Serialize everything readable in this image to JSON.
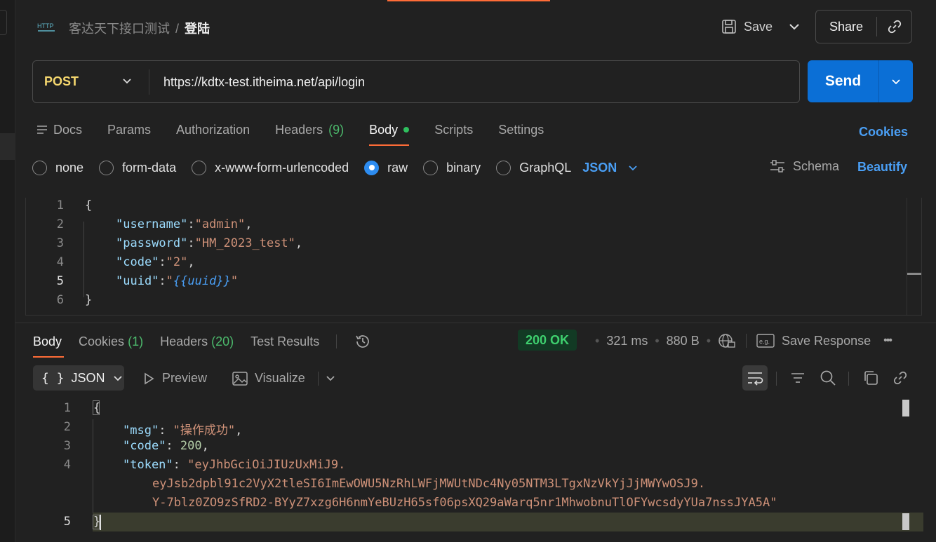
{
  "header": {
    "collection": "客达天下接口测试",
    "separator": "/",
    "request_name": "登陆",
    "save_label": "Save",
    "share_label": "Share"
  },
  "request": {
    "method": "POST",
    "url": "https://kdtx-test.itheima.net/api/login",
    "send_label": "Send"
  },
  "req_tabs": {
    "docs": "Docs",
    "params": "Params",
    "authorization": "Authorization",
    "headers": "Headers",
    "headers_count": "(9)",
    "body": "Body",
    "scripts": "Scripts",
    "settings": "Settings",
    "cookies": "Cookies"
  },
  "body_types": {
    "none": "none",
    "form_data": "form-data",
    "urlencoded": "x-www-form-urlencoded",
    "raw": "raw",
    "binary": "binary",
    "graphql": "GraphQL",
    "format": "JSON",
    "schema": "Schema",
    "beautify": "Beautify"
  },
  "request_body": {
    "line_numbers": [
      "1",
      "2",
      "3",
      "4",
      "5",
      "6"
    ],
    "open": "{",
    "close": "}",
    "fields": [
      {
        "key": "\"username\"",
        "value": "\"admin\"",
        "comma": ","
      },
      {
        "key": "\"password\"",
        "value": "\"HM_2023_test\"",
        "comma": ","
      },
      {
        "key": "\"code\"",
        "value": "\"2\"",
        "comma": ","
      }
    ],
    "uuid_key": "\"uuid\"",
    "uuid_var": "{{uuid}}"
  },
  "response_tabs": {
    "body": "Body",
    "cookies": "Cookies",
    "cookies_count": "(1)",
    "headers": "Headers",
    "headers_count": "(20)",
    "test_results": "Test Results"
  },
  "response_meta": {
    "status": "200 OK",
    "time": "321 ms",
    "size": "880 B",
    "bullet": "•",
    "save_response": "Save Response",
    "more": "•••"
  },
  "response_toolbar": {
    "format": "JSON",
    "format_icon": "{ }",
    "preview": "Preview",
    "visualize": "Visualize"
  },
  "response_body": {
    "line_numbers": [
      "1",
      "2",
      "3",
      "4",
      "",
      "",
      "5"
    ],
    "open": "{",
    "close": "}",
    "msg_key": "\"msg\"",
    "msg_value": "\"操作成功\"",
    "code_key": "\"code\"",
    "code_value": "200",
    "token_key": "\"token\"",
    "token_line1": "\"eyJhbGciOiJIUzUxMiJ9.",
    "token_line2": "eyJsb2dpbl91c2VyX2tleSI6ImEwOWU5NzRhLWFjMWUtNDc4Ny05NTM3LTgxNzVkYjJjMWYwOSJ9.",
    "token_line3": "Y-7blz0ZO9zSfRD2-BYyZ7xzg6H6nmYeBUzH65sf06psXQ29aWarq5nr1MhwobnuTlOFYwcsdyYUa7nssJYA5A\""
  },
  "colors": {
    "accent": "#ff6c37",
    "send": "#0b6fd6",
    "link": "#4a9ff5",
    "status_ok": "#3ecf6e",
    "method": "#f5d76e"
  }
}
